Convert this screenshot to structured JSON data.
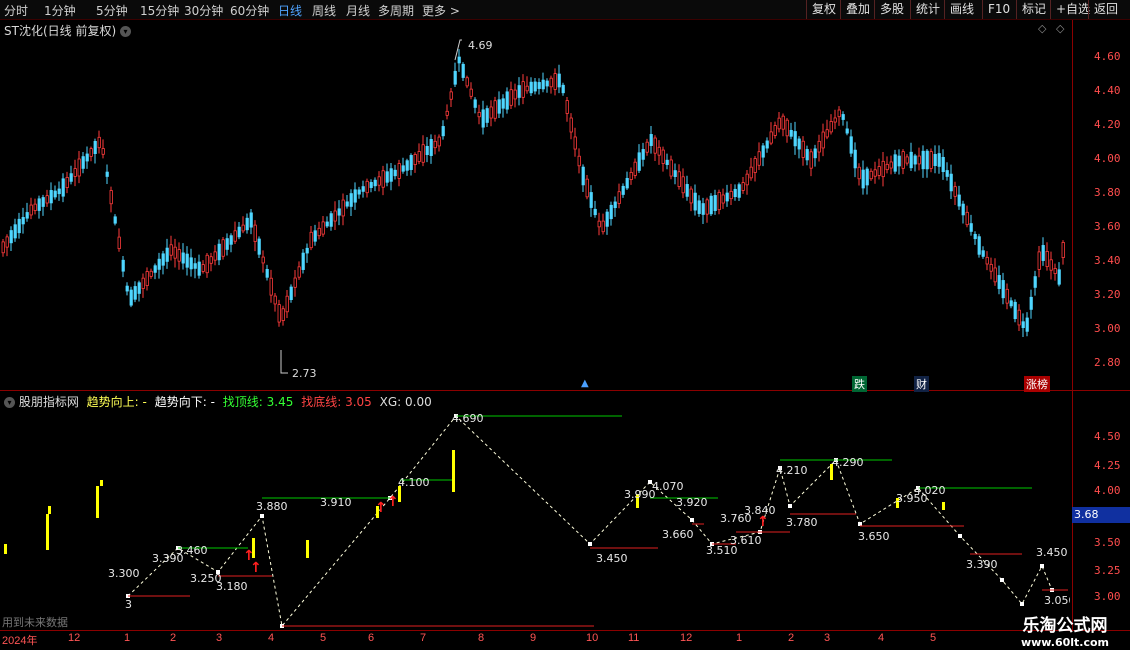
{
  "toolbar": {
    "periods": [
      "分时",
      "1分钟",
      "5分钟",
      "15分钟",
      "30分钟",
      "60分钟",
      "日线",
      "周线",
      "月线",
      "多周期",
      "更多 >"
    ],
    "active": "日线",
    "right_buttons": [
      "复权",
      "叠加",
      "多股",
      "统计",
      "画线",
      "F10",
      "标记",
      "+自选",
      "返回"
    ]
  },
  "main_panel": {
    "title": "ST沈化(日线 前复权)",
    "y_ticks": [
      "4.60",
      "4.40",
      "4.20",
      "4.00",
      "3.80",
      "3.60",
      "3.40",
      "3.20",
      "3.00",
      "2.80"
    ],
    "high_label": "4.69",
    "low_label": "2.73",
    "badges": [
      "跌",
      "财",
      "涨榜"
    ]
  },
  "indicator_panel": {
    "name": "股朋指标网",
    "trend_up_label": "趋势向上:",
    "trend_up_value": "-",
    "trend_down_label": "趋势向下:",
    "trend_down_value": "-",
    "top_line_label": "找顶线:",
    "top_line_value": "3.45",
    "bottom_line_label": "找底线:",
    "bottom_line_value": "3.05",
    "xg_label": "XG:",
    "xg_value": "0.00",
    "y_ticks": [
      "4.50",
      "4.25",
      "4.00",
      "3.75",
      "3.50",
      "3.25",
      "3.00"
    ],
    "current_value": "3.68",
    "footer": "用到未来数据",
    "point_labels": [
      "3",
      "3.300",
      "3.390",
      "3.460",
      "3.250",
      "3.180",
      "3.880",
      "3.910",
      "4.100",
      "4.690",
      "3.450",
      "3.990",
      "4.070",
      "3.920",
      "3.660",
      "3.510",
      "3.760",
      "3.610",
      "3.840",
      "4.210",
      "3.780",
      "4.290",
      "3.650",
      "3.950",
      "4.020",
      "3.390",
      "3.450",
      "3.050"
    ]
  },
  "x_axis": [
    "2024年",
    "12",
    "1",
    "2",
    "3",
    "4",
    "5",
    "6",
    "7",
    "8",
    "9",
    "10",
    "11",
    "12",
    "1",
    "2",
    "3",
    "4",
    "5"
  ],
  "watermark": {
    "line1": "乐淘公式网",
    "line2": "www.60lt.com"
  },
  "colors": {
    "up": "#ff3b3b",
    "down": "#4fd6ff",
    "grid": "#8b0000",
    "top_line": "#00c800",
    "bottom_line": "#e02020",
    "bar": "#ffff00"
  }
}
